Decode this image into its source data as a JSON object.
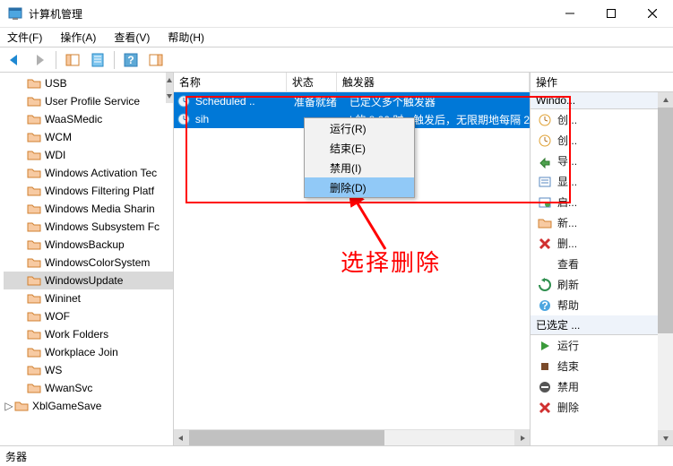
{
  "window": {
    "title": "计算机管理"
  },
  "menu": {
    "file": "文件(F)",
    "action": "操作(A)",
    "view": "查看(V)",
    "help": "帮助(H)"
  },
  "tree": {
    "items": [
      {
        "label": "USB"
      },
      {
        "label": "User Profile Service"
      },
      {
        "label": "WaaSMedic"
      },
      {
        "label": "WCM"
      },
      {
        "label": "WDI"
      },
      {
        "label": "Windows Activation Tec"
      },
      {
        "label": "Windows Filtering Platf"
      },
      {
        "label": "Windows Media Sharin"
      },
      {
        "label": "Windows Subsystem Fc"
      },
      {
        "label": "WindowsBackup"
      },
      {
        "label": "WindowsColorSystem"
      },
      {
        "label": "WindowsUpdate"
      },
      {
        "label": "Wininet"
      },
      {
        "label": "WOF"
      },
      {
        "label": "Work Folders"
      },
      {
        "label": "Workplace Join"
      },
      {
        "label": "WS"
      },
      {
        "label": "WwanSvc"
      },
      {
        "label": "XblGameSave"
      }
    ],
    "selected_index": 11
  },
  "list": {
    "columns": {
      "name": "名称",
      "status": "状态",
      "trigger": "触发器"
    },
    "rows": [
      {
        "name": "Scheduled ..",
        "status": "准备就绪",
        "trigger": "已定义多个触发器"
      },
      {
        "name": "sih",
        "status": "",
        "trigger": "| 的 8:00 时 - 触发后，无限期地每隔 2"
      }
    ]
  },
  "ctx": {
    "run": "运行(R)",
    "end": "结束(E)",
    "disable": "禁用(I)",
    "delete": "删除(D)"
  },
  "actions": {
    "title": "操作",
    "section1": "Windo...",
    "items1": [
      {
        "label": "创..."
      },
      {
        "label": "创..."
      },
      {
        "label": "导..."
      },
      {
        "label": "显..."
      },
      {
        "label": "启..."
      },
      {
        "label": "新..."
      },
      {
        "label": "删..."
      },
      {
        "label": "查看"
      },
      {
        "label": "刷新"
      },
      {
        "label": "帮助"
      }
    ],
    "section2": "已选定 ...",
    "items2": [
      {
        "label": "运行"
      },
      {
        "label": "结束"
      },
      {
        "label": "禁用"
      },
      {
        "label": "删除"
      }
    ]
  },
  "status": {
    "text": "务器"
  },
  "annotation": {
    "label": "选择删除"
  }
}
